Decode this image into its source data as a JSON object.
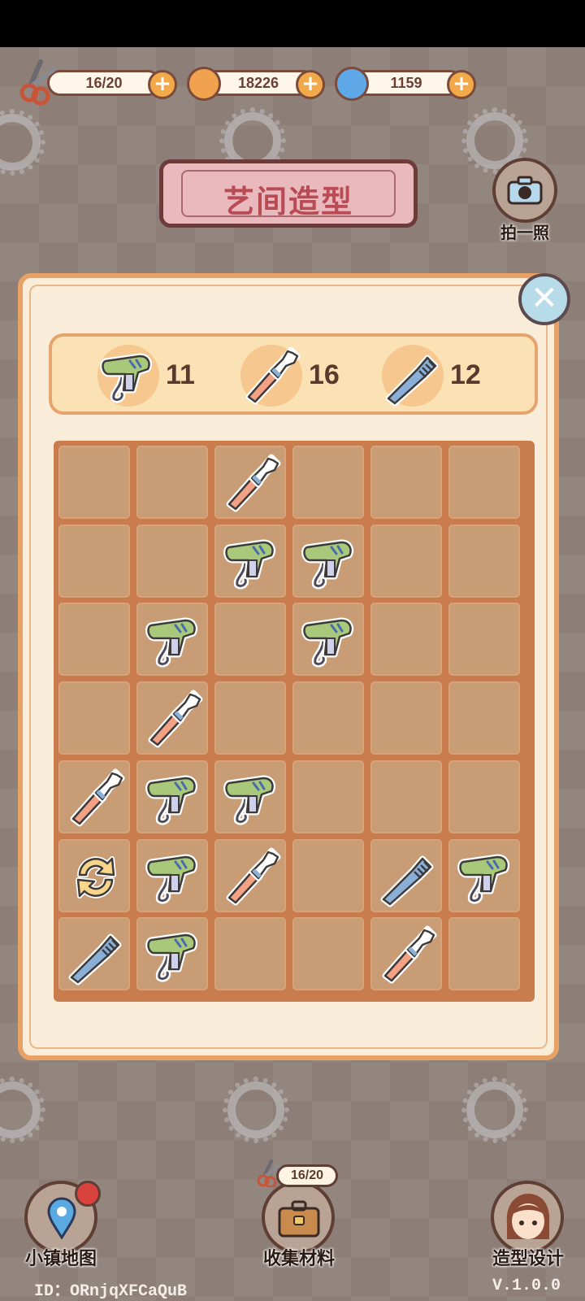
{
  "resources": {
    "scissors": {
      "value": "16/20",
      "icon": "scissors-icon"
    },
    "coins": {
      "value": "18226",
      "icon": "coin-icon"
    },
    "gems": {
      "value": "1159",
      "icon": "swirl-gem-icon"
    },
    "plus_label": "+"
  },
  "header": {
    "title": "艺间造型"
  },
  "camera": {
    "label": "拍一照",
    "icon": "camera-icon"
  },
  "goals": [
    {
      "icon": "hair-dryer-icon",
      "count": "11"
    },
    {
      "icon": "makeup-brush-icon",
      "count": "16"
    },
    {
      "icon": "comb-icon",
      "count": "12"
    }
  ],
  "board": {
    "rows": 7,
    "cols": 6,
    "cells": [
      [
        "",
        "",
        "brush",
        "",
        "",
        ""
      ],
      [
        "",
        "",
        "dryer",
        "dryer",
        "",
        ""
      ],
      [
        "",
        "dryer",
        "",
        "dryer",
        "",
        ""
      ],
      [
        "",
        "brush",
        "",
        "",
        "",
        ""
      ],
      [
        "brush",
        "dryer",
        "dryer",
        "",
        "",
        ""
      ],
      [
        "refresh",
        "dryer",
        "brush",
        "",
        "comb",
        "dryer"
      ],
      [
        "comb",
        "dryer",
        "",
        "",
        "brush",
        ""
      ]
    ]
  },
  "close": {
    "label": "✕"
  },
  "nav": {
    "map": {
      "label": "小镇地图",
      "icon": "map-pin-icon"
    },
    "collect": {
      "label": "收集材料",
      "icon": "toolbox-icon",
      "counter": "16/20"
    },
    "design": {
      "label": "造型设计",
      "icon": "avatar-icon"
    }
  },
  "footer": {
    "id": "ID：ORnjqXFCaQuB",
    "version": "V.1.0.0"
  },
  "colors": {
    "panel": "#f9ecd9",
    "board": "#c97d4e",
    "cell": "#c89c75",
    "accent": "#f2a94a"
  }
}
